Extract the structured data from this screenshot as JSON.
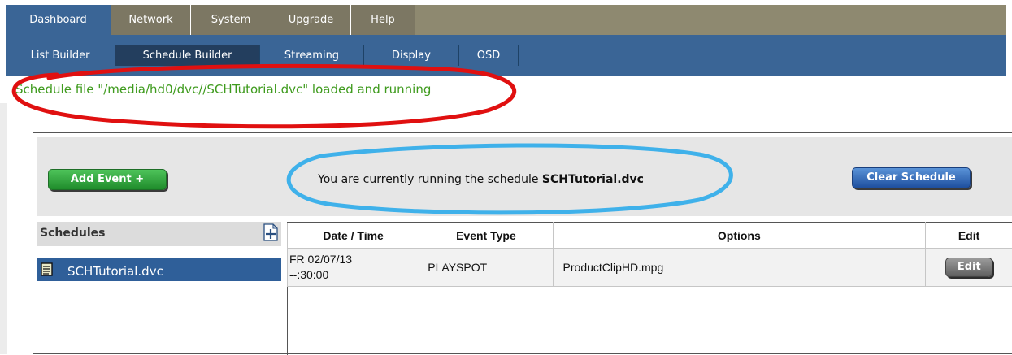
{
  "nav": {
    "tabs": [
      {
        "label": "Dashboard",
        "active": true
      },
      {
        "label": "Network",
        "active": false
      },
      {
        "label": "System",
        "active": false
      },
      {
        "label": "Upgrade",
        "active": false
      },
      {
        "label": "Help",
        "active": false
      }
    ],
    "subtabs": [
      {
        "label": "List Builder",
        "active": false
      },
      {
        "label": "Schedule Builder",
        "active": true
      },
      {
        "label": "Streaming",
        "active": false
      },
      {
        "label": "Display",
        "active": false
      },
      {
        "label": "OSD",
        "active": false
      }
    ]
  },
  "status": {
    "message": "Schedule file \"/media/hd0/dvc//SCHTutorial.dvc\" loaded and running"
  },
  "panel": {
    "add_event_label": "Add Event +",
    "clear_schedule_label": "Clear Schedule",
    "running_prefix": "You are currently running the schedule ",
    "running_schedule": "SCHTutorial.dvc"
  },
  "schedules": {
    "title": "Schedules",
    "items": [
      {
        "label": "SCHTutorial.dvc",
        "selected": true
      }
    ]
  },
  "events": {
    "columns": [
      "Date / Time",
      "Event Type",
      "Options",
      "Edit"
    ],
    "rows": [
      {
        "date": "FR 02/07/13",
        "time": "--:30:00",
        "event_type": "PLAYSPOT",
        "options": "ProductClipHD.mpg",
        "edit_label": "Edit"
      }
    ]
  },
  "colors": {
    "nav_inactive": "#7c7763",
    "nav_active": "#3a6596",
    "status_green": "#3f9b1e",
    "annotation_red": "#e01010",
    "annotation_blue": "#3fb1ea"
  }
}
